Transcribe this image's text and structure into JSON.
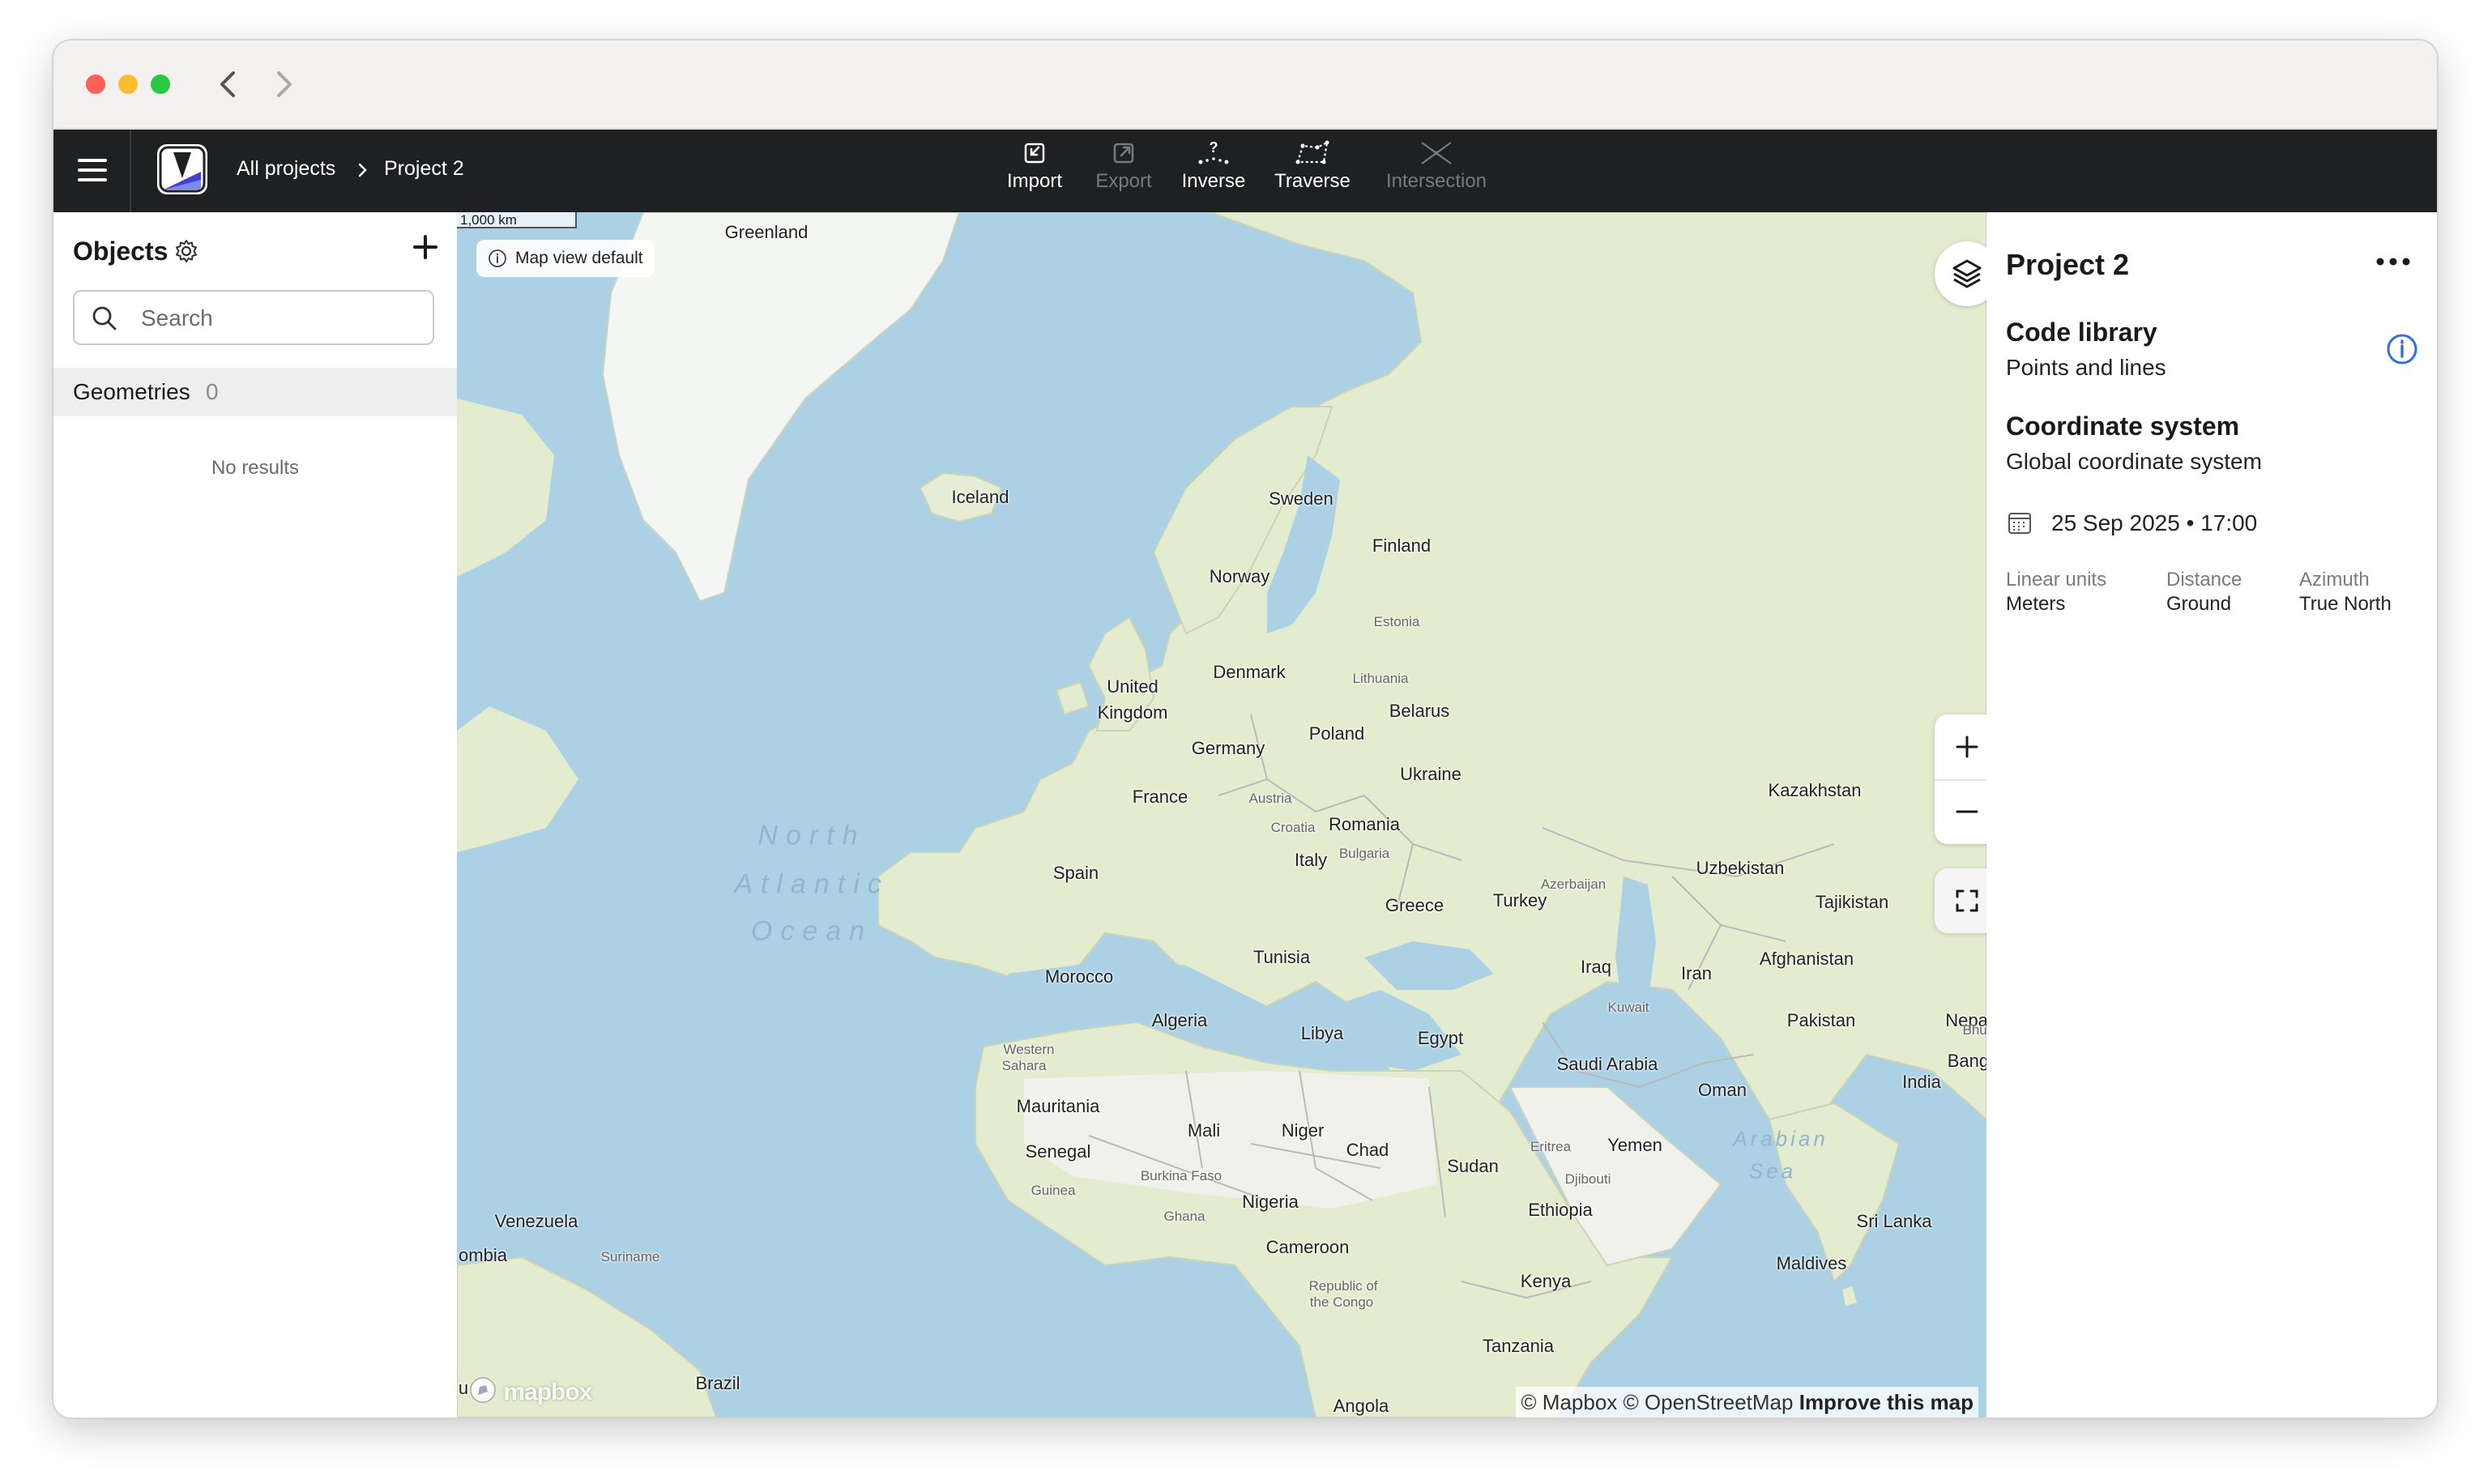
{
  "breadcrumb": {
    "all_projects": "All projects",
    "current": "Project 2"
  },
  "toolbar": [
    {
      "label": "Import",
      "icon": "import-icon",
      "enabled": true
    },
    {
      "label": "Export",
      "icon": "export-icon",
      "enabled": false
    },
    {
      "label": "Inverse",
      "icon": "inverse-icon",
      "enabled": true
    },
    {
      "label": "Traverse",
      "icon": "traverse-icon",
      "enabled": true
    },
    {
      "label": "Intersection",
      "icon": "intersection-icon",
      "enabled": false
    }
  ],
  "objects_panel": {
    "title": "Objects",
    "search_placeholder": "Search",
    "geometries_label": "Geometries",
    "geometries_count": "0",
    "empty_text": "No results"
  },
  "map": {
    "scale_label": "1,000 km",
    "view_pill": "Map view default",
    "attribution": {
      "mapbox": "© Mapbox",
      "osm": "© OpenStreetMap",
      "improve": "Improve this map"
    },
    "logo_text": "mapbox",
    "ocean_lines": [
      "North",
      "Atlantic",
      "Ocean"
    ],
    "countries": [
      "Greenland",
      "Iceland",
      "Sweden",
      "Finland",
      "Norway",
      "Estonia",
      "Denmark",
      "Lithuania",
      "United",
      "Kingdom",
      "Belarus",
      "Poland",
      "Germany",
      "Ukraine",
      "France",
      "Austria",
      "Romania",
      "Croatia",
      "Kazakhstan",
      "Bulgaria",
      "Spain",
      "Italy",
      "Azerbaijan",
      "Uzbekistan",
      "Greece",
      "Turkey",
      "Tajikistan",
      "Morocco",
      "Tunisia",
      "Iraq",
      "Iran",
      "Afghanistan",
      "Kuwait",
      "Algeria",
      "Libya",
      "Egypt",
      "Pakistan",
      "Nepal",
      "Bhut",
      "Western",
      "Sahara",
      "Saudi Arabia",
      "Bangla",
      "Mauritania",
      "Oman",
      "India",
      "Mali",
      "Niger",
      "Senegal",
      "Chad",
      "Eritrea",
      "Yemen",
      "Arabian",
      "Sea",
      "Burkina Faso",
      "Sudan",
      "Guinea",
      "Djibouti",
      "Nigeria",
      "Ghana",
      "Ethiopia",
      "Venezuela",
      "Sri Lanka",
      "Cameroon",
      "ombia",
      "Suriname",
      "Maldives",
      "Republic of",
      "the Congo",
      "Kenya",
      "Tanzania",
      "Brazil",
      "Angola",
      "u"
    ]
  },
  "project_panel": {
    "title": "Project 2",
    "code_library_heading": "Code library",
    "code_library_value": "Points and lines",
    "coordinate_heading": "Coordinate system",
    "coordinate_value": "Global coordinate system",
    "date": "25 Sep 2025 • 17:00",
    "units": [
      {
        "label": "Linear units",
        "value": "Meters"
      },
      {
        "label": "Distance",
        "value": "Ground"
      },
      {
        "label": "Azimuth",
        "value": "True North"
      }
    ]
  },
  "colors": {
    "topbar": "#1f2021",
    "water": "#acd1e5",
    "land": "#e4ecd0",
    "desert": "#f1f1ec",
    "accent": "#2f6fe0"
  }
}
